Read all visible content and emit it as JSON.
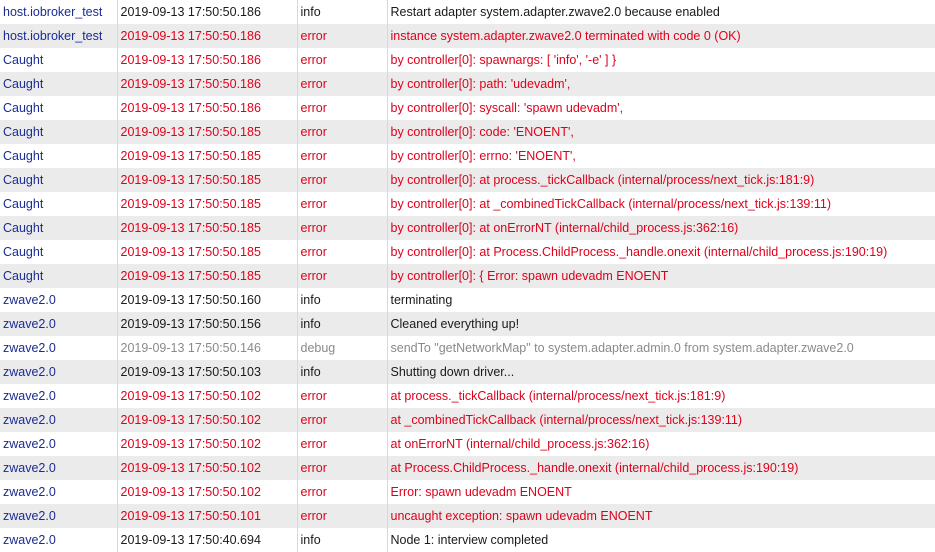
{
  "log": {
    "rows": [
      {
        "source": "host.iobroker_test",
        "time": "2019-09-13 17:50:50.186",
        "level": "info",
        "message": "Restart adapter system.adapter.zwave2.0 because enabled"
      },
      {
        "source": "host.iobroker_test",
        "time": "2019-09-13 17:50:50.186",
        "level": "error",
        "message": "instance system.adapter.zwave2.0 terminated with code 0 (OK)"
      },
      {
        "source": "Caught",
        "time": "2019-09-13 17:50:50.186",
        "level": "error",
        "message": "by controller[0]: spawnargs: [ 'info', '-e' ] }"
      },
      {
        "source": "Caught",
        "time": "2019-09-13 17:50:50.186",
        "level": "error",
        "message": "by controller[0]: path: 'udevadm',"
      },
      {
        "source": "Caught",
        "time": "2019-09-13 17:50:50.186",
        "level": "error",
        "message": "by controller[0]: syscall: 'spawn udevadm',"
      },
      {
        "source": "Caught",
        "time": "2019-09-13 17:50:50.185",
        "level": "error",
        "message": "by controller[0]: code: 'ENOENT',"
      },
      {
        "source": "Caught",
        "time": "2019-09-13 17:50:50.185",
        "level": "error",
        "message": "by controller[0]: errno: 'ENOENT',"
      },
      {
        "source": "Caught",
        "time": "2019-09-13 17:50:50.185",
        "level": "error",
        "message": "by controller[0]: at process._tickCallback (internal/process/next_tick.js:181:9)"
      },
      {
        "source": "Caught",
        "time": "2019-09-13 17:50:50.185",
        "level": "error",
        "message": "by controller[0]: at _combinedTickCallback (internal/process/next_tick.js:139:11)"
      },
      {
        "source": "Caught",
        "time": "2019-09-13 17:50:50.185",
        "level": "error",
        "message": "by controller[0]: at onErrorNT (internal/child_process.js:362:16)"
      },
      {
        "source": "Caught",
        "time": "2019-09-13 17:50:50.185",
        "level": "error",
        "message": "by controller[0]: at Process.ChildProcess._handle.onexit (internal/child_process.js:190:19)"
      },
      {
        "source": "Caught",
        "time": "2019-09-13 17:50:50.185",
        "level": "error",
        "message": "by controller[0]: { Error: spawn udevadm ENOENT"
      },
      {
        "source": "zwave2.0",
        "time": "2019-09-13 17:50:50.160",
        "level": "info",
        "message": "terminating"
      },
      {
        "source": "zwave2.0",
        "time": "2019-09-13 17:50:50.156",
        "level": "info",
        "message": "Cleaned everything up!"
      },
      {
        "source": "zwave2.0",
        "time": "2019-09-13 17:50:50.146",
        "level": "debug",
        "message": "sendTo \"getNetworkMap\" to system.adapter.admin.0 from system.adapter.zwave2.0"
      },
      {
        "source": "zwave2.0",
        "time": "2019-09-13 17:50:50.103",
        "level": "info",
        "message": "Shutting down driver..."
      },
      {
        "source": "zwave2.0",
        "time": "2019-09-13 17:50:50.102",
        "level": "error",
        "message": "at process._tickCallback (internal/process/next_tick.js:181:9)"
      },
      {
        "source": "zwave2.0",
        "time": "2019-09-13 17:50:50.102",
        "level": "error",
        "message": "at _combinedTickCallback (internal/process/next_tick.js:139:11)"
      },
      {
        "source": "zwave2.0",
        "time": "2019-09-13 17:50:50.102",
        "level": "error",
        "message": "at onErrorNT (internal/child_process.js:362:16)"
      },
      {
        "source": "zwave2.0",
        "time": "2019-09-13 17:50:50.102",
        "level": "error",
        "message": "at Process.ChildProcess._handle.onexit (internal/child_process.js:190:19)"
      },
      {
        "source": "zwave2.0",
        "time": "2019-09-13 17:50:50.102",
        "level": "error",
        "message": "Error: spawn udevadm ENOENT"
      },
      {
        "source": "zwave2.0",
        "time": "2019-09-13 17:50:50.101",
        "level": "error",
        "message": "uncaught exception: spawn udevadm ENOENT"
      },
      {
        "source": "zwave2.0",
        "time": "2019-09-13 17:50:40.694",
        "level": "info",
        "message": "Node 1: interview completed"
      }
    ]
  },
  "colors": {
    "source_text": "#1a2c94",
    "info_text": "#1a1a1a",
    "error_text": "#e0001a",
    "debug_text": "#8a8a8a",
    "row_alt_bg": "#ebebeb"
  }
}
